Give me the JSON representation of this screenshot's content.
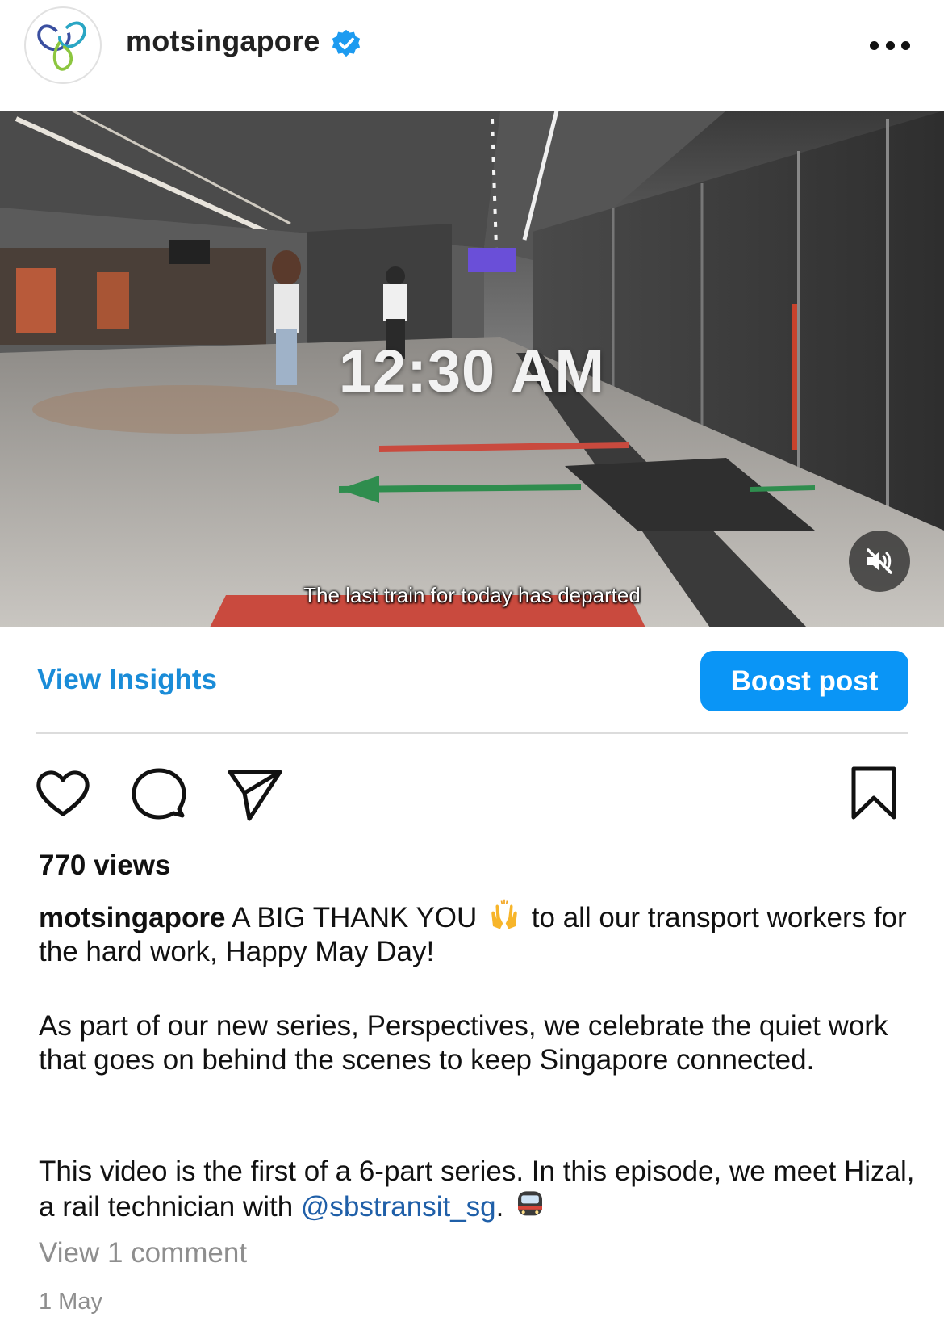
{
  "header": {
    "username": "motsingapore",
    "verified_icon": "verified-badge-icon",
    "more_icon": "more-options-icon"
  },
  "media": {
    "time_overlay": "12:30 AM",
    "subtitle": "The last train for today has departed",
    "mute_icon": "speaker-muted-icon"
  },
  "insights": {
    "view_insights_label": "View Insights",
    "boost_label": "Boost post"
  },
  "actions": {
    "like_icon": "heart-icon",
    "comment_icon": "comment-icon",
    "share_icon": "paper-plane-icon",
    "save_icon": "bookmark-icon"
  },
  "post": {
    "views": "770 views",
    "caption_user": "motsingapore",
    "caption_part1": "A BIG THANK YOU",
    "caption_part1_emoji": "raised-hands-emoji",
    "caption_part2": "to all our transport workers for the hard work, Happy May Day!",
    "paragraph2": "As part of our new series, Perspectives, we celebrate the quiet work that goes on behind the scenes to keep Singapore connected.",
    "paragraph3_prefix": "This video is the first of a 6-part series. In this episode, we meet Hizal, a rail technician with",
    "mention": "@sbstransit_sg",
    "paragraph3_suffix": ".",
    "paragraph3_emoji": "train-emoji",
    "view_comments": "View 1 comment",
    "date": "1 May"
  },
  "colors": {
    "link_blue": "#1a8cd8",
    "boost_blue": "#0a95f6",
    "mention_blue": "#1f5fa8",
    "muted_gray": "#8e8e8e"
  }
}
